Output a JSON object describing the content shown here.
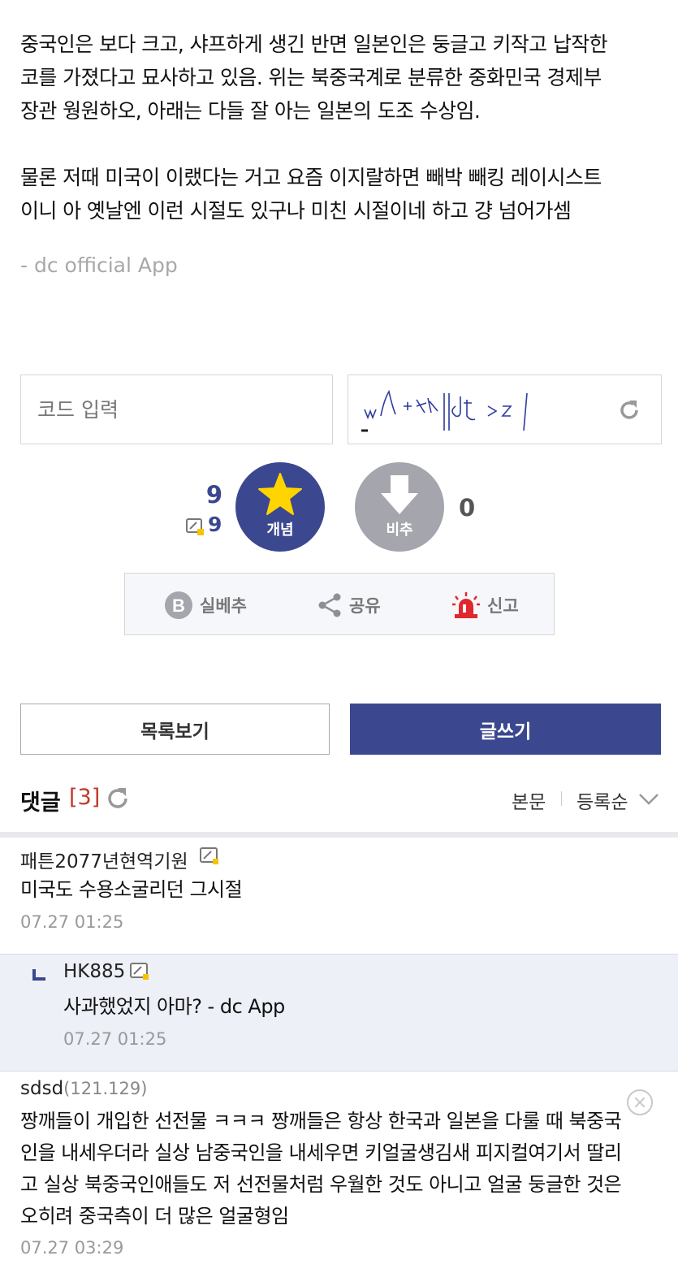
{
  "article": {
    "lines": [
      "중국인은 보다 크고, 샤프하게 생긴 반면 일본인은 둥글고 키작고 납작한",
      "코를 가졌다고 묘사하고 있음. 위는 북중국계로 분류한 중화민국 경제부",
      "장관 웡원하오, 아래는 다들 잘 아는 일본의 도조 수상임.",
      "물론 저때 미국이 이랬다는 거고 요즘 이지랄하면 빼박 빼킹 레이시스트",
      "이니 아 옛날엔 이런 시절도 있구나 미친 시절이네 하고 걍 넘어가셈"
    ],
    "signature": "- dc official App"
  },
  "captcha": {
    "placeholder": "코드 입력",
    "image_text": "w+%lilk|dh>>z/"
  },
  "vote": {
    "up_count": "9",
    "fix_count": "9",
    "up_label": "개념",
    "down_label": "비추",
    "down_count": "0"
  },
  "actions": {
    "best": "실베추",
    "share": "공유",
    "report": "신고"
  },
  "buttons": {
    "list": "목록보기",
    "write": "글쓰기"
  },
  "comments_header": {
    "title": "댓글",
    "count": "[3]",
    "sort_body": "본문",
    "sort_order": "등록순"
  },
  "comments": [
    {
      "nick": "패튼2077년현역기원",
      "ip": "",
      "text": [
        "미국도 수용소굴리던 그시절"
      ],
      "date": "07.27 01:25"
    },
    {
      "nick": "HK885",
      "ip": "",
      "text": [
        "사과했었지 아마? - dc App"
      ],
      "date": "07.27 01:25"
    },
    {
      "nick": "sdsd",
      "ip": "(121.129)",
      "text": [
        "짱깨들이 개입한 선전물 ㅋㅋㅋ 짱깨들은 항상 한국과 일본을 다룰 때 북중국",
        "인을 내세우더라 실상 남중국인을 내세우면 키얼굴생김새 피지컬여기서 딸리",
        "고 실상 북중국인애들도 저 선전물처럼 우월한 것도 아니고 얼굴 둥글한 것은",
        "오히려 중국측이 더 많은 얼굴형임"
      ],
      "date": "07.27 03:29"
    }
  ],
  "colors": {
    "primary": "#3b4890",
    "downvote": "#a5a5ad",
    "star": "#ffd400",
    "report": "#e0282d",
    "count_red": "#c0392b"
  }
}
